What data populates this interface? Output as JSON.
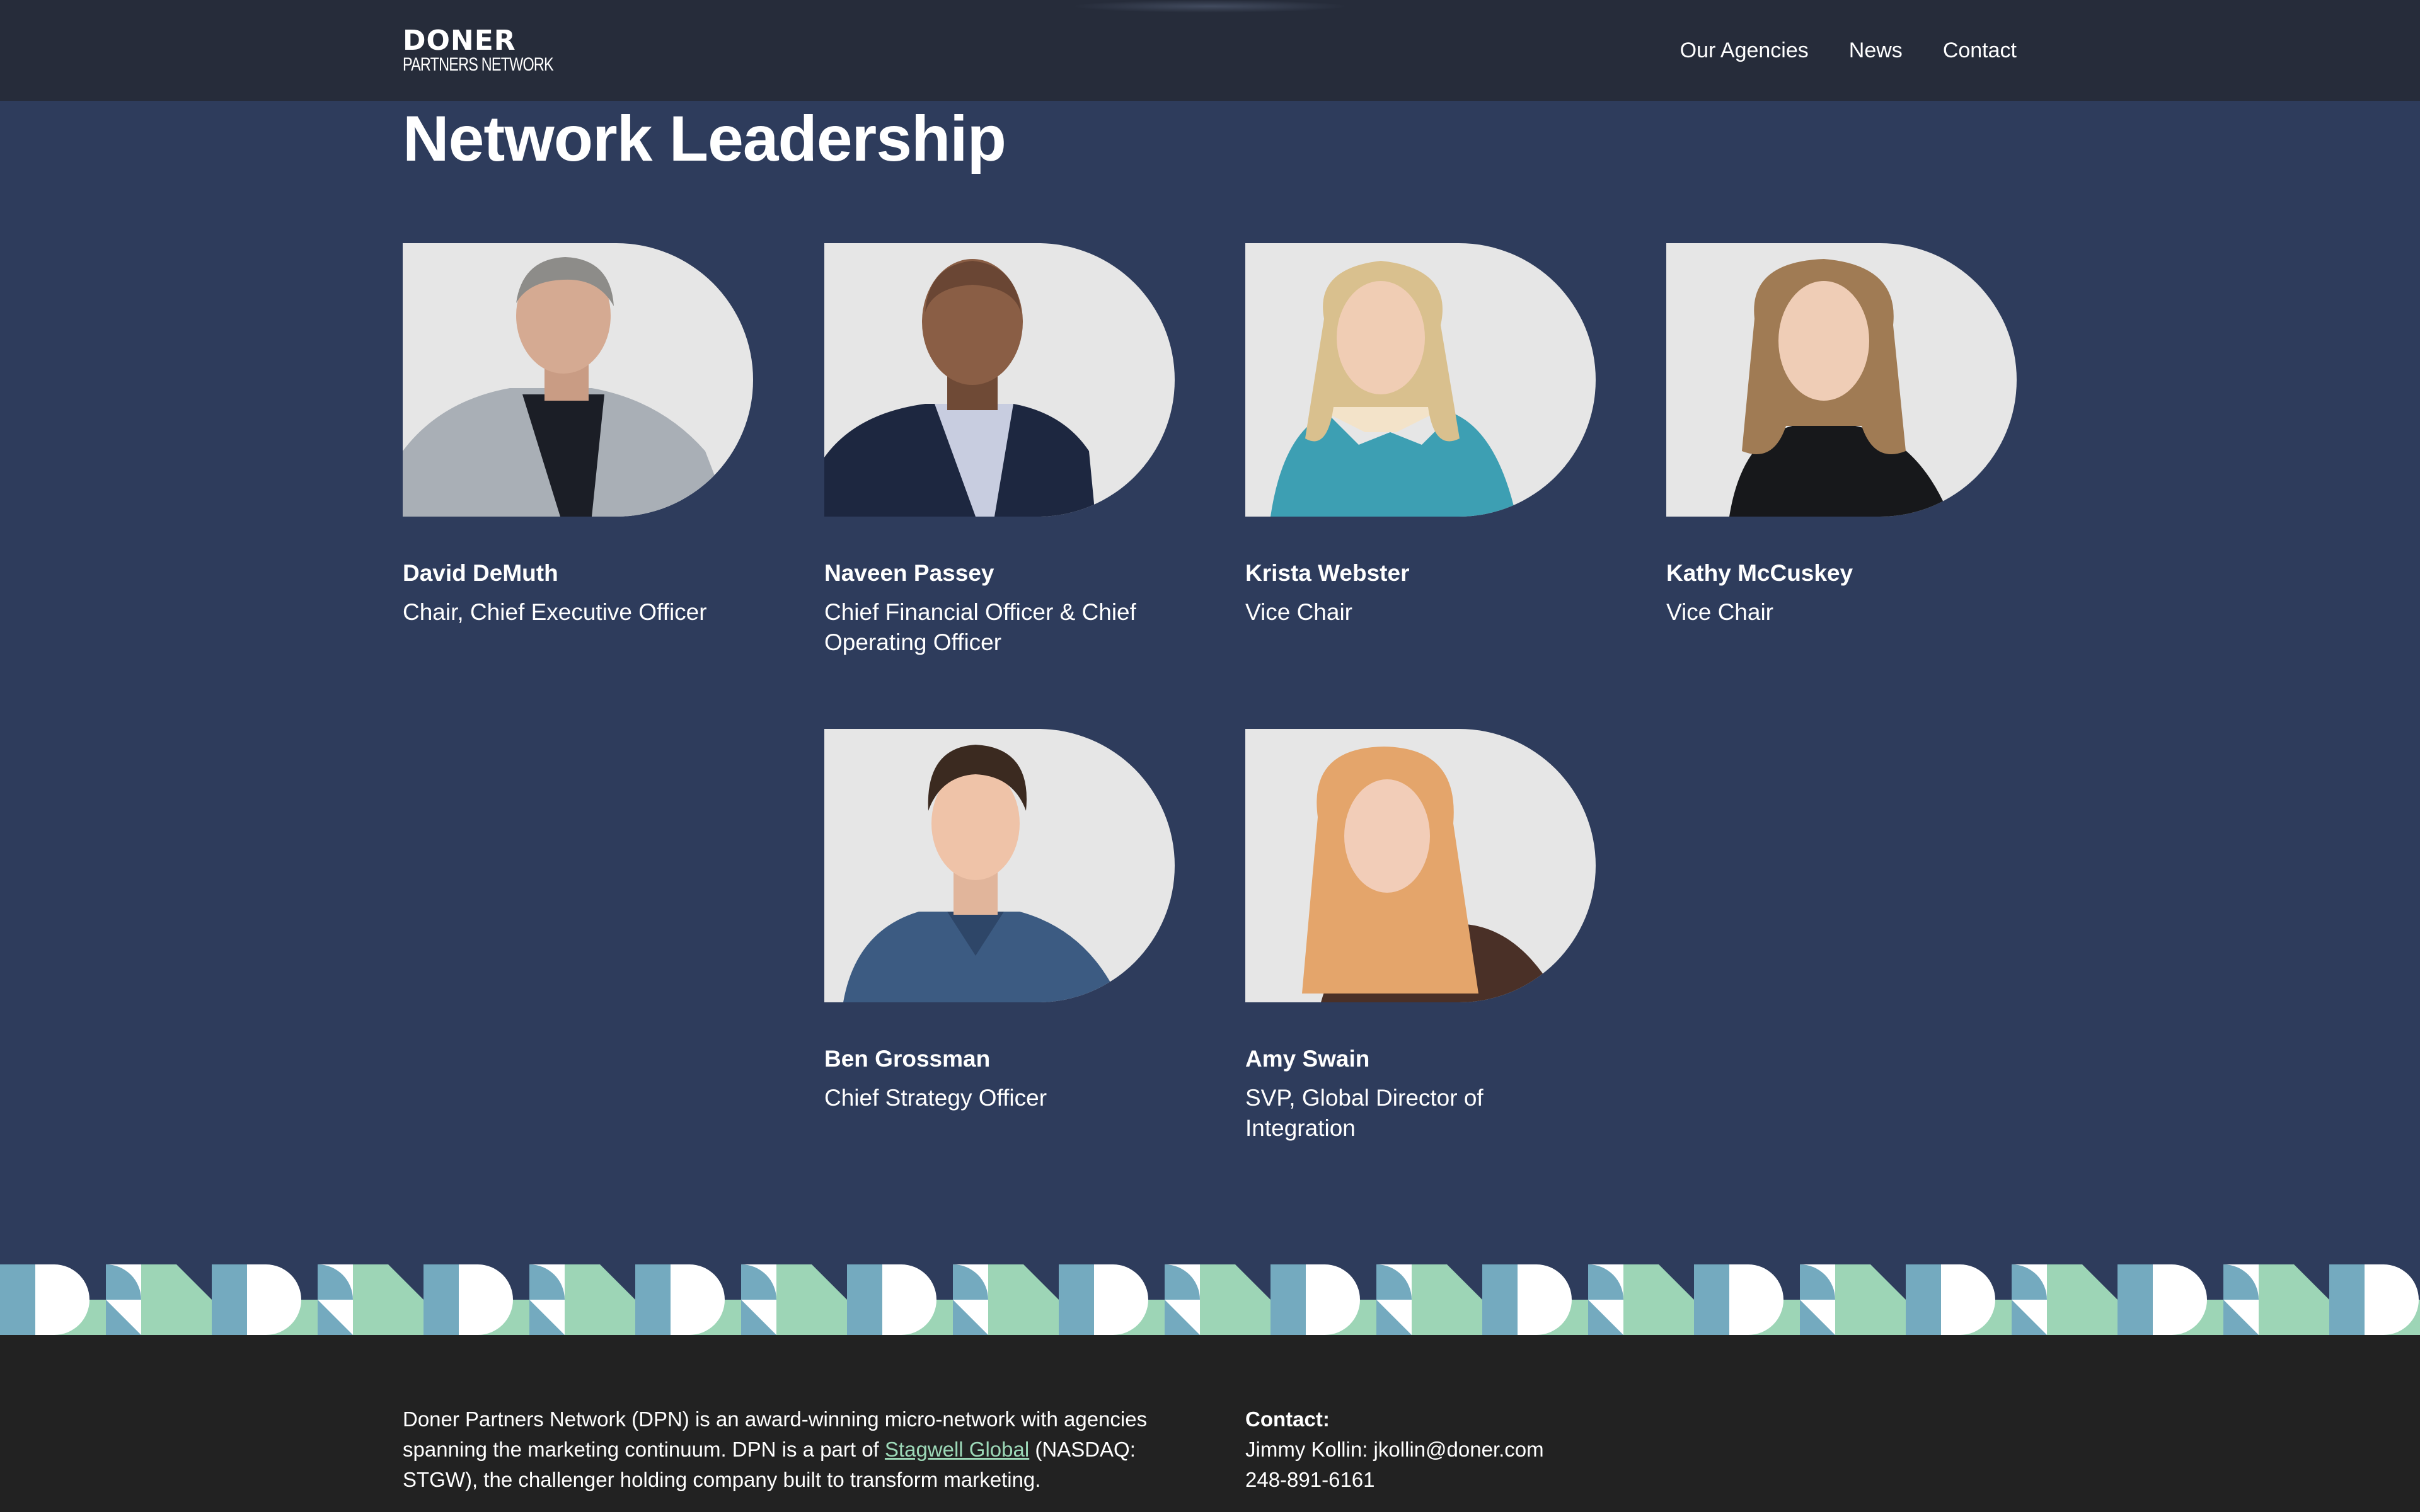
{
  "header": {
    "logo_word": "DONER",
    "logo_sub": "PARTNERS NETWORK",
    "nav": [
      "Our Agencies",
      "News",
      "Contact"
    ]
  },
  "main": {
    "title": "Network Leadership",
    "leaders": [
      {
        "name": "David DeMuth",
        "role": "Chair, Chief Executive Officer"
      },
      {
        "name": "Naveen Passey",
        "role": "Chief Financial Officer & Chief Operating Officer"
      },
      {
        "name": "Krista Webster",
        "role": "Vice Chair"
      },
      {
        "name": "Kathy McCuskey",
        "role": "Vice Chair"
      },
      {
        "name": "Ben Grossman",
        "role": "Chief Strategy Officer"
      },
      {
        "name": "Amy Swain",
        "role": "SVP, Global Director of Integration"
      }
    ]
  },
  "footer": {
    "about_before": "Doner Partners Network (DPN) is an award-winning micro-network with agencies spanning the marketing continuum. DPN is a part of ",
    "about_link": "Stagwell Global",
    "about_after": " (NASDAQ: STGW), the challenger holding company built to transform marketing.",
    "contact_title": "Contact:",
    "contact_person": "Jimmy Kollin: jkollin@doner.com",
    "contact_phone": "248-891-6161"
  },
  "colors": {
    "page_bg": "#2e3c5c",
    "header_bg": "#262c3a",
    "footer_bg": "#222222",
    "pattern_teal": "#74aabf",
    "pattern_mint": "#9dd5b6",
    "link": "#9dd9b8"
  }
}
